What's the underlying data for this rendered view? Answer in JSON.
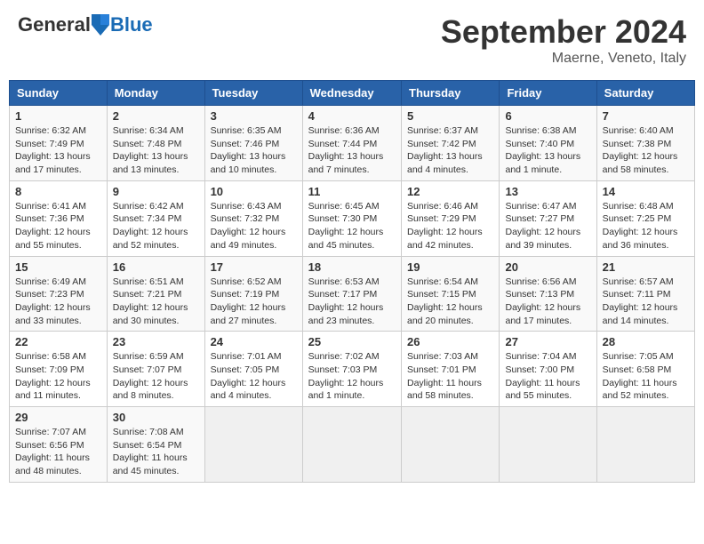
{
  "header": {
    "logo_general": "General",
    "logo_blue": "Blue",
    "month_title": "September 2024",
    "subtitle": "Maerne, Veneto, Italy"
  },
  "days_of_week": [
    "Sunday",
    "Monday",
    "Tuesday",
    "Wednesday",
    "Thursday",
    "Friday",
    "Saturday"
  ],
  "weeks": [
    [
      {
        "day": "1",
        "detail": "Sunrise: 6:32 AM\nSunset: 7:49 PM\nDaylight: 13 hours and 17 minutes."
      },
      {
        "day": "2",
        "detail": "Sunrise: 6:34 AM\nSunset: 7:48 PM\nDaylight: 13 hours and 13 minutes."
      },
      {
        "day": "3",
        "detail": "Sunrise: 6:35 AM\nSunset: 7:46 PM\nDaylight: 13 hours and 10 minutes."
      },
      {
        "day": "4",
        "detail": "Sunrise: 6:36 AM\nSunset: 7:44 PM\nDaylight: 13 hours and 7 minutes."
      },
      {
        "day": "5",
        "detail": "Sunrise: 6:37 AM\nSunset: 7:42 PM\nDaylight: 13 hours and 4 minutes."
      },
      {
        "day": "6",
        "detail": "Sunrise: 6:38 AM\nSunset: 7:40 PM\nDaylight: 13 hours and 1 minute."
      },
      {
        "day": "7",
        "detail": "Sunrise: 6:40 AM\nSunset: 7:38 PM\nDaylight: 12 hours and 58 minutes."
      }
    ],
    [
      {
        "day": "8",
        "detail": "Sunrise: 6:41 AM\nSunset: 7:36 PM\nDaylight: 12 hours and 55 minutes."
      },
      {
        "day": "9",
        "detail": "Sunrise: 6:42 AM\nSunset: 7:34 PM\nDaylight: 12 hours and 52 minutes."
      },
      {
        "day": "10",
        "detail": "Sunrise: 6:43 AM\nSunset: 7:32 PM\nDaylight: 12 hours and 49 minutes."
      },
      {
        "day": "11",
        "detail": "Sunrise: 6:45 AM\nSunset: 7:30 PM\nDaylight: 12 hours and 45 minutes."
      },
      {
        "day": "12",
        "detail": "Sunrise: 6:46 AM\nSunset: 7:29 PM\nDaylight: 12 hours and 42 minutes."
      },
      {
        "day": "13",
        "detail": "Sunrise: 6:47 AM\nSunset: 7:27 PM\nDaylight: 12 hours and 39 minutes."
      },
      {
        "day": "14",
        "detail": "Sunrise: 6:48 AM\nSunset: 7:25 PM\nDaylight: 12 hours and 36 minutes."
      }
    ],
    [
      {
        "day": "15",
        "detail": "Sunrise: 6:49 AM\nSunset: 7:23 PM\nDaylight: 12 hours and 33 minutes."
      },
      {
        "day": "16",
        "detail": "Sunrise: 6:51 AM\nSunset: 7:21 PM\nDaylight: 12 hours and 30 minutes."
      },
      {
        "day": "17",
        "detail": "Sunrise: 6:52 AM\nSunset: 7:19 PM\nDaylight: 12 hours and 27 minutes."
      },
      {
        "day": "18",
        "detail": "Sunrise: 6:53 AM\nSunset: 7:17 PM\nDaylight: 12 hours and 23 minutes."
      },
      {
        "day": "19",
        "detail": "Sunrise: 6:54 AM\nSunset: 7:15 PM\nDaylight: 12 hours and 20 minutes."
      },
      {
        "day": "20",
        "detail": "Sunrise: 6:56 AM\nSunset: 7:13 PM\nDaylight: 12 hours and 17 minutes."
      },
      {
        "day": "21",
        "detail": "Sunrise: 6:57 AM\nSunset: 7:11 PM\nDaylight: 12 hours and 14 minutes."
      }
    ],
    [
      {
        "day": "22",
        "detail": "Sunrise: 6:58 AM\nSunset: 7:09 PM\nDaylight: 12 hours and 11 minutes."
      },
      {
        "day": "23",
        "detail": "Sunrise: 6:59 AM\nSunset: 7:07 PM\nDaylight: 12 hours and 8 minutes."
      },
      {
        "day": "24",
        "detail": "Sunrise: 7:01 AM\nSunset: 7:05 PM\nDaylight: 12 hours and 4 minutes."
      },
      {
        "day": "25",
        "detail": "Sunrise: 7:02 AM\nSunset: 7:03 PM\nDaylight: 12 hours and 1 minute."
      },
      {
        "day": "26",
        "detail": "Sunrise: 7:03 AM\nSunset: 7:01 PM\nDaylight: 11 hours and 58 minutes."
      },
      {
        "day": "27",
        "detail": "Sunrise: 7:04 AM\nSunset: 7:00 PM\nDaylight: 11 hours and 55 minutes."
      },
      {
        "day": "28",
        "detail": "Sunrise: 7:05 AM\nSunset: 6:58 PM\nDaylight: 11 hours and 52 minutes."
      }
    ],
    [
      {
        "day": "29",
        "detail": "Sunrise: 7:07 AM\nSunset: 6:56 PM\nDaylight: 11 hours and 48 minutes."
      },
      {
        "day": "30",
        "detail": "Sunrise: 7:08 AM\nSunset: 6:54 PM\nDaylight: 11 hours and 45 minutes."
      },
      {
        "day": "",
        "detail": ""
      },
      {
        "day": "",
        "detail": ""
      },
      {
        "day": "",
        "detail": ""
      },
      {
        "day": "",
        "detail": ""
      },
      {
        "day": "",
        "detail": ""
      }
    ]
  ]
}
